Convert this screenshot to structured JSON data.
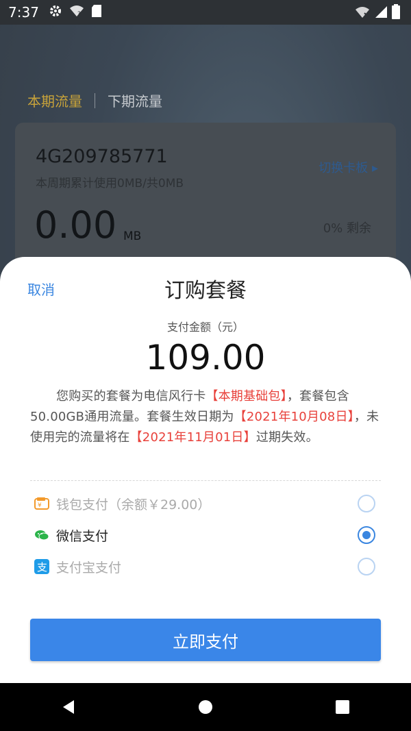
{
  "status_bar": {
    "time": "7:37"
  },
  "background": {
    "tabs": [
      {
        "label": "本期流量"
      },
      {
        "label": "下期流量"
      }
    ],
    "card": {
      "number": "4G209785771",
      "usage": "本周期累计使用0MB/共0MB",
      "switch": "切换卡板",
      "amount": "0.00",
      "unit": "MB",
      "remaining": "0% 剩余"
    }
  },
  "sheet": {
    "cancel": "取消",
    "title": "订购套餐",
    "amount_label": "支付金额（元）",
    "amount": "109.00",
    "desc": {
      "t1": "您购买的套餐为电信风行卡",
      "h1": "【本期基础包】",
      "t2": "，套餐包含50.00GB通用流量。套餐生效日期为",
      "h2": "【2021年10月08日】",
      "t3": "，未使用完的流量将在",
      "h3": "【2021年11月01日】",
      "t4": "过期失效。"
    },
    "payments": [
      {
        "label": "钱包支付（余额￥29.00）",
        "icon": "wallet-icon",
        "selected": false,
        "color": "#aaaaaa"
      },
      {
        "label": "微信支付",
        "icon": "wechat-icon",
        "selected": true,
        "color": "#222222"
      },
      {
        "label": "支付宝支付",
        "icon": "alipay-icon",
        "selected": false,
        "color": "#aaaaaa"
      }
    ],
    "pay_button": "立即支付"
  },
  "colors": {
    "accent": "#3a86e8",
    "highlight": "#e8403a"
  }
}
